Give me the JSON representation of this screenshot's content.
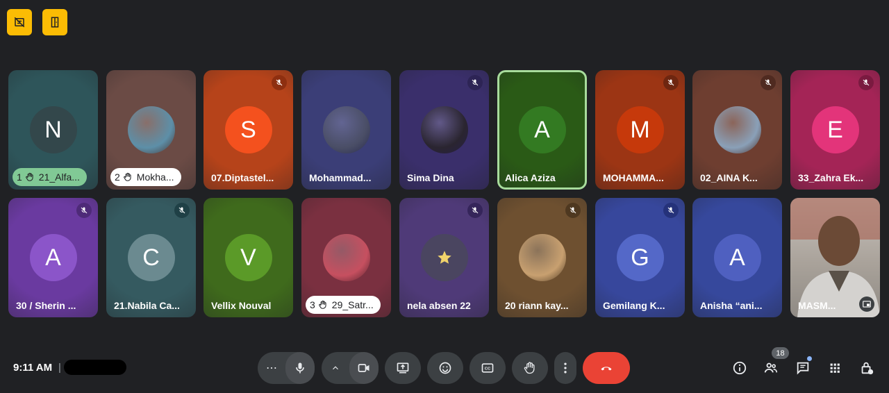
{
  "top_buttons": [
    {
      "icon": "no-video-doc-icon"
    },
    {
      "icon": "door-exit-icon"
    }
  ],
  "participants": [
    {
      "name": "21_Alfa...",
      "hand_order": "1",
      "pill_color": "#81c995",
      "avatar_letter": "N",
      "avatar_bg": "#33474b",
      "tile_bg": "#2e555a",
      "muted": false
    },
    {
      "name": "Mokha...",
      "hand_order": "2",
      "pill_color": "#ffffff",
      "avatar_letter": "",
      "avatar_image": "photo",
      "avatar_bg": "#5d8fa8",
      "tile_bg": "#6b4b45",
      "muted": false
    },
    {
      "name": "07.Diptastel...",
      "avatar_letter": "S",
      "avatar_bg": "#f4511e",
      "tile_bg": "#b6431a",
      "muted": true,
      "mute_bg": "#8e2f10"
    },
    {
      "name": "Mohammad...",
      "avatar_letter": "",
      "avatar_image": "photo",
      "avatar_bg": "#4a4e66",
      "tile_bg": "#3b3e77",
      "muted": false
    },
    {
      "name": "Sima Dina",
      "avatar_letter": "",
      "avatar_image": "photo",
      "avatar_bg": "#2a2530",
      "tile_bg": "#3a2f6b",
      "muted": true,
      "mute_bg": "#2d2455"
    },
    {
      "name": "Alica Aziza",
      "avatar_letter": "A",
      "avatar_bg": "#337a22",
      "tile_bg": "#2a5a16",
      "muted": false,
      "active": true
    },
    {
      "name": "MOHAMMA...",
      "avatar_letter": "M",
      "avatar_bg": "#c6390b",
      "tile_bg": "#9c3514",
      "muted": true,
      "mute_bg": "#6e2610"
    },
    {
      "name": "02_AINA K...",
      "avatar_letter": "",
      "avatar_image": "photo",
      "avatar_bg": "#8aa0b8",
      "tile_bg": "#6e3e30",
      "muted": true,
      "mute_bg": "#4f2a20"
    },
    {
      "name": "33_Zahra Ek...",
      "avatar_letter": "E",
      "avatar_bg": "#e3347a",
      "tile_bg": "#a42456",
      "muted": true,
      "mute_bg": "#7a1a40"
    },
    {
      "name": "30 / Sherin ...",
      "avatar_letter": "A",
      "avatar_bg": "#8b55c9",
      "tile_bg": "#6a3aa0",
      "muted": true,
      "mute_bg": "#4e2a78"
    },
    {
      "name": "21.Nabila Ca...",
      "avatar_letter": "C",
      "avatar_bg": "#6b8a90",
      "tile_bg": "#355a60",
      "muted": true,
      "mute_bg": "#1f4046"
    },
    {
      "name": "Vellix Nouval",
      "avatar_letter": "V",
      "avatar_bg": "#5b9a28",
      "tile_bg": "#3f6a1c",
      "muted": false
    },
    {
      "name": "29_Satr...",
      "hand_order": "3",
      "pill_color": "#ffffff",
      "avatar_letter": "",
      "avatar_image": "photo",
      "avatar_bg": "#c65060",
      "tile_bg": "#7a3040",
      "muted": false
    },
    {
      "name": "nela absen 22",
      "avatar_letter": "",
      "avatar_image": "star",
      "avatar_bg": "#4a4560",
      "tile_bg": "#4f3a78",
      "muted": true,
      "mute_bg": "#35255a"
    },
    {
      "name": "20 riann kay...",
      "avatar_letter": "",
      "avatar_image": "photo",
      "avatar_bg": "#c8a070",
      "tile_bg": "#6e5030",
      "muted": true,
      "mute_bg": "#4e3820"
    },
    {
      "name": "Gemilang K...",
      "avatar_letter": "G",
      "avatar_bg": "#5468c8",
      "tile_bg": "#37479c",
      "muted": true,
      "mute_bg": "#25327a"
    },
    {
      "name": "Anisha “ani...",
      "avatar_letter": "A",
      "avatar_bg": "#4f60c0",
      "tile_bg": "#36489c",
      "muted": false
    },
    {
      "name": "MASM...",
      "avatar_letter": "",
      "avatar_image": "video",
      "avatar_bg": "#c9c6c2",
      "tile_bg": "#b8b5b0",
      "muted": false,
      "video": true
    }
  ],
  "bottom_bar": {
    "time": "9:11 AM",
    "separator": "|",
    "participant_count": "18",
    "controls": [
      {
        "name": "more-audio-button",
        "icon": "ellipsis-icon"
      },
      {
        "name": "mic-button",
        "icon": "mic-icon"
      },
      {
        "name": "more-video-button",
        "icon": "chevron-up-icon"
      },
      {
        "name": "camera-button",
        "icon": "camera-icon"
      },
      {
        "name": "present-button",
        "icon": "present-icon"
      },
      {
        "name": "emoji-button",
        "icon": "emoji-icon"
      },
      {
        "name": "captions-button",
        "icon": "captions-icon"
      },
      {
        "name": "raise-hand-button",
        "icon": "hand-icon"
      },
      {
        "name": "more-options-button",
        "icon": "more-vert-icon"
      },
      {
        "name": "end-call-button",
        "icon": "end-call-icon",
        "color": "#ea4335"
      }
    ],
    "right_icons": [
      "info-icon",
      "people-icon",
      "chat-icon",
      "activities-icon",
      "host-controls-icon"
    ]
  }
}
